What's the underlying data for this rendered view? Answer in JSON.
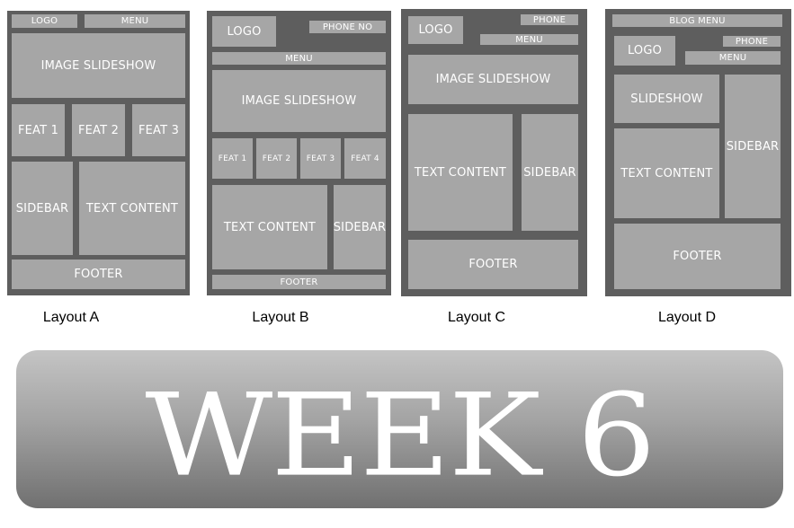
{
  "layouts": {
    "a": {
      "logo": "LOGO",
      "menu": "MENU",
      "slideshow": "IMAGE SLIDESHOW",
      "feat1": "FEAT 1",
      "feat2": "FEAT 2",
      "feat3": "FEAT 3",
      "sidebar": "SIDEBAR",
      "text": "TEXT CONTENT",
      "footer": "FOOTER",
      "caption": "Layout A"
    },
    "b": {
      "logo": "LOGO",
      "phone": "PHONE NO",
      "menu": "MENU",
      "slideshow": "IMAGE SLIDESHOW",
      "feat1": "FEAT 1",
      "feat2": "FEAT 2",
      "feat3": "FEAT 3",
      "feat4": "FEAT 4",
      "text": "TEXT CONTENT",
      "sidebar": "SIDEBAR",
      "footer": "FOOTER",
      "caption": "Layout B"
    },
    "c": {
      "logo": "LOGO",
      "phone": "PHONE",
      "menu": "MENU",
      "slideshow": "IMAGE SLIDESHOW",
      "text": "TEXT CONTENT",
      "sidebar": "SIDEBAR",
      "footer": "FOOTER",
      "caption": "Layout C"
    },
    "d": {
      "blog_menu": "BLOG MENU",
      "logo": "LOGO",
      "phone": "PHONE",
      "menu": "MENU",
      "slideshow": "SLIDESHOW",
      "text": "TEXT CONTENT",
      "sidebar": "SIDEBAR",
      "footer": "FOOTER",
      "caption": "Layout D"
    }
  },
  "banner": {
    "title": "WEEK 6"
  },
  "colors": {
    "frame": "#5e5e5e",
    "block": "#a6a6a6",
    "block_text": "#ffffff"
  }
}
